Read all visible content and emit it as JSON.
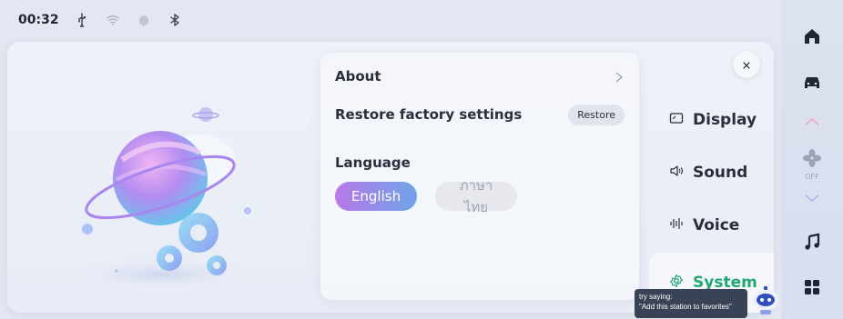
{
  "status_bar": {
    "time": "00:32",
    "icons": [
      "usb-icon",
      "wifi-icon",
      "fingerprint-icon",
      "bluetooth-icon"
    ]
  },
  "settings": {
    "about_label": "About",
    "restore_label": "Restore factory settings",
    "restore_button": "Restore",
    "language_label": "Language",
    "languages": [
      {
        "label": "English",
        "selected": true
      },
      {
        "label": "ภาษาไทย",
        "selected": false
      }
    ]
  },
  "side_menu": {
    "close_icon": "close-icon",
    "items": [
      {
        "label": "Display",
        "icon": "display-icon",
        "active": false
      },
      {
        "label": "Sound",
        "icon": "speaker-icon",
        "active": false
      },
      {
        "label": "Voice",
        "icon": "waveform-icon",
        "active": false
      },
      {
        "label": "System",
        "icon": "gear-icon",
        "active": true
      }
    ]
  },
  "hint": {
    "line1": "try saying:",
    "line2": "\"Add this station to favorites\""
  },
  "rail": {
    "icons": [
      "home-icon",
      "car-icon",
      "chevron-up-icon",
      "fan-icon",
      "chevron-down-icon",
      "music-icon",
      "grid-icon"
    ],
    "fan_state": "OFF"
  },
  "colors": {
    "accent_green": "#1fa872",
    "language_gradient_start": "#b878e8",
    "language_gradient_end": "#6ea4e8",
    "text_dark": "#2a2f3d"
  }
}
